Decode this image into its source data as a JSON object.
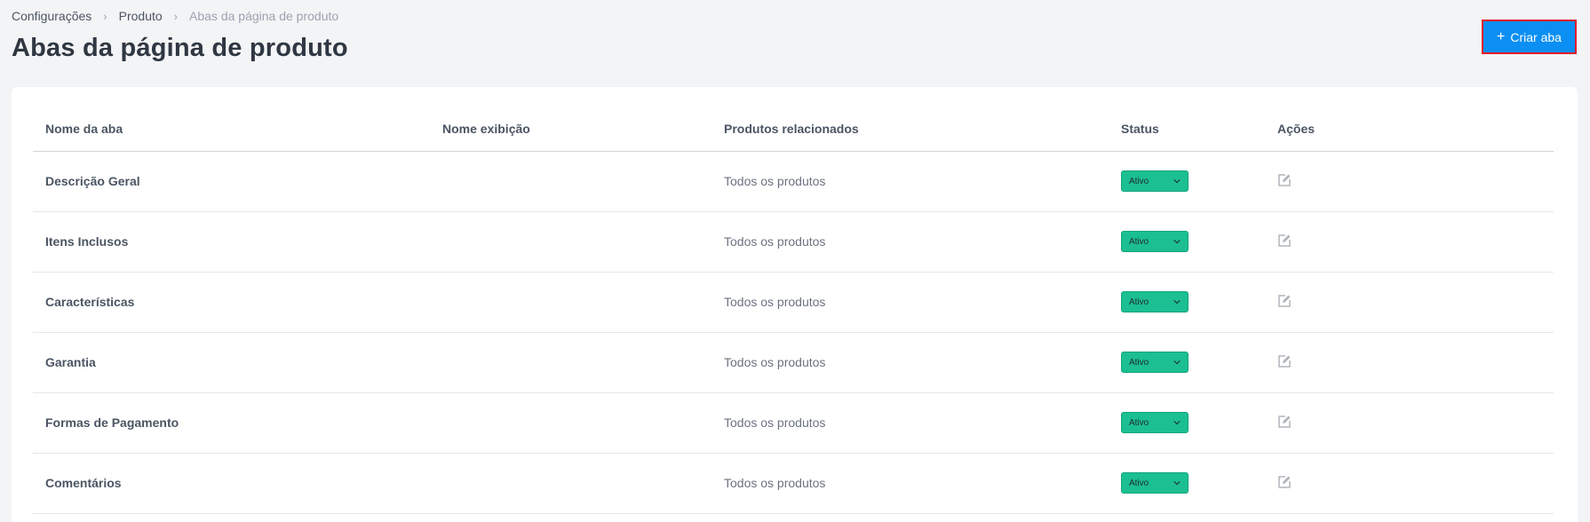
{
  "breadcrumb": {
    "items": [
      "Configurações",
      "Produto",
      "Abas da página de produto"
    ]
  },
  "page": {
    "title": "Abas da página de produto"
  },
  "toolbar": {
    "create_label": "Criar aba",
    "create_icon": "plus-icon"
  },
  "table": {
    "columns": [
      "Nome da aba",
      "Nome exibição",
      "Produtos relacionados",
      "Status",
      "Ações"
    ],
    "rows": [
      {
        "name": "Descrição Geral",
        "display_name": "",
        "related": "Todos os produtos",
        "status": "Ativo"
      },
      {
        "name": "Itens Inclusos",
        "display_name": "",
        "related": "Todos os produtos",
        "status": "Ativo"
      },
      {
        "name": "Características",
        "display_name": "",
        "related": "Todos os produtos",
        "status": "Ativo"
      },
      {
        "name": "Garantia",
        "display_name": "",
        "related": "Todos os produtos",
        "status": "Ativo"
      },
      {
        "name": "Formas de Pagamento",
        "display_name": "",
        "related": "Todos os produtos",
        "status": "Ativo"
      },
      {
        "name": "Comentários",
        "display_name": "",
        "related": "Todos os produtos",
        "status": "Ativo"
      }
    ]
  },
  "colors": {
    "accent": "#0b8ff3",
    "status_active": "#1bbf92",
    "highlight_border": "#e11d2a"
  }
}
